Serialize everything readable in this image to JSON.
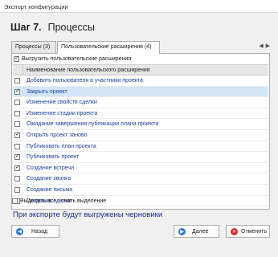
{
  "window": {
    "title": "Экспорт конфигурации"
  },
  "header": {
    "step_label": "Шаг 7.",
    "step_title": "Процессы"
  },
  "tabs": [
    {
      "label": "Процессы (3)",
      "active": false
    },
    {
      "label": "Пользовательские расширения (4)",
      "active": true
    }
  ],
  "tab_nav": {
    "prev": "◀",
    "next": "▶"
  },
  "options": {
    "export_extensions_label": "Выгрузить пользовательские расширения",
    "export_extensions_checked": true
  },
  "grid": {
    "column_header": "Наименование пользовательского расширения",
    "rows": [
      {
        "name": "Добавить пользователя в участники проекта",
        "checked": false,
        "selected": false
      },
      {
        "name": "Закрыть проект",
        "checked": true,
        "selected": true
      },
      {
        "name": "Изменение свойств сделки",
        "checked": false,
        "selected": false
      },
      {
        "name": "Изменение стадии проекта",
        "checked": false,
        "selected": false
      },
      {
        "name": "Ожидание завершения публикации плана проекта",
        "checked": false,
        "selected": false
      },
      {
        "name": "Открыть проект заново",
        "checked": true,
        "selected": false
      },
      {
        "name": "Публиковать план проекта",
        "checked": false,
        "selected": false
      },
      {
        "name": "Публиковать проект",
        "checked": true,
        "selected": false
      },
      {
        "name": "Создание встречи",
        "checked": true,
        "selected": false
      },
      {
        "name": "Создание звонка",
        "checked": false,
        "selected": false
      },
      {
        "name": "Создание письма",
        "checked": false,
        "selected": false
      },
      {
        "name": "Создание сделки",
        "checked": false,
        "selected": false
      }
    ]
  },
  "select_all": {
    "label": "Выделить все / снять выделение",
    "checked": false
  },
  "note": "При экспорте будут выгружены черновики",
  "buttons": {
    "back": {
      "label": "Назад",
      "icon": "arrow-left-icon"
    },
    "next": {
      "label": "Далее",
      "icon": "arrow-right-icon"
    },
    "cancel": {
      "label": "Отменить",
      "icon": "close-icon"
    }
  }
}
